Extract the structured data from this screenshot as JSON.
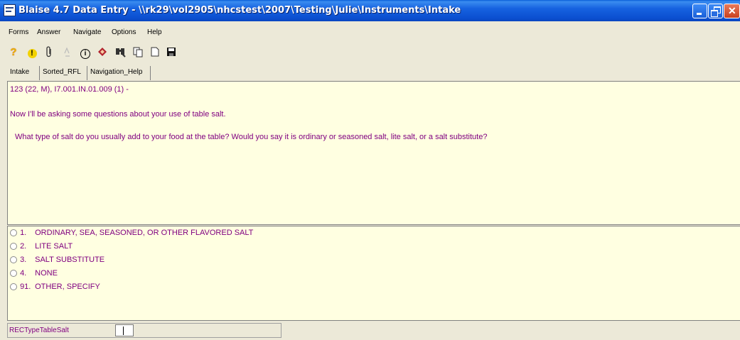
{
  "window": {
    "title": "Blaise 4.7 Data Entry - \\\\rk29\\vol2905\\nhcstest\\2007\\Testing\\Julie\\Instruments\\Intake"
  },
  "menu": [
    "Forms",
    "Answer",
    "Navigate",
    "Options",
    "Help"
  ],
  "toolbar": {
    "icons": [
      "help-icon",
      "info-alert-icon",
      "paperclip-icon",
      "remark-icon",
      "info-icon",
      "watch-icon",
      "find-icon",
      "copy-icon",
      "new-form-icon",
      "save-icon"
    ],
    "help_glyph": "?",
    "alert_glyph": "!",
    "info_glyph": "i"
  },
  "tabs": [
    "Intake",
    "Sorted_RFL",
    "Navigation_Help"
  ],
  "question": {
    "header": "123 (22, M),         I7.001.IN.01.009  (1) -",
    "intro": "Now I'll be asking some questions about your use of table salt.",
    "text": "What type of salt do you usually add to your food at the table? Would you say it is ordinary or seasoned salt, lite salt, or a salt substitute?"
  },
  "answers": [
    {
      "code": "1.",
      "label": "ORDINARY, SEA, SEASONED, OR OTHER FLAVORED SALT"
    },
    {
      "code": "2.",
      "label": "LITE SALT"
    },
    {
      "code": "3.",
      "label": "SALT SUBSTITUTE"
    },
    {
      "code": "4.",
      "label": "NONE"
    },
    {
      "code": "91.",
      "label": "OTHER, SPECIFY"
    }
  ],
  "status": {
    "field_name": "RECTypeTableSalt",
    "field_value": ""
  },
  "colors": {
    "text_purple": "#800080",
    "panel_bg": "#ffffe1",
    "titlebar_blue": "#0b4fd0"
  }
}
